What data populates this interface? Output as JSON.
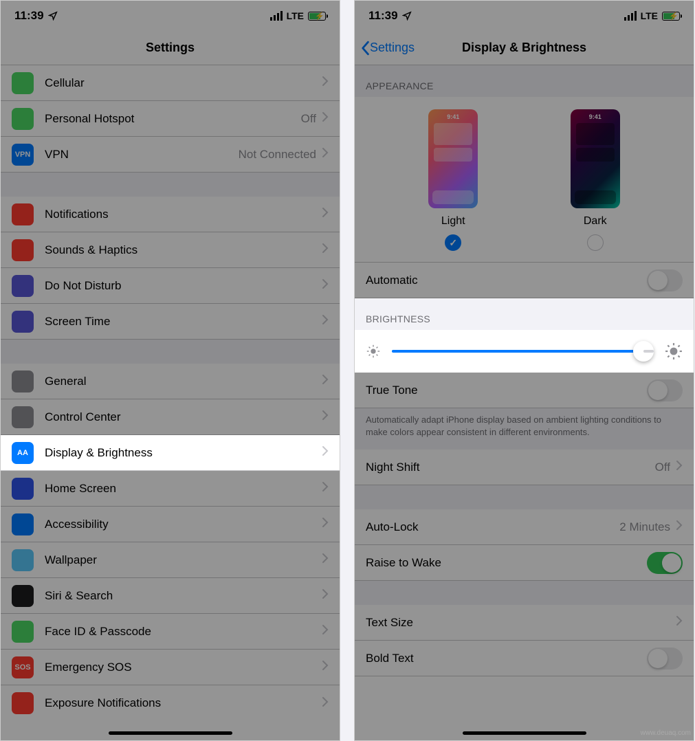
{
  "status": {
    "time": "11:39",
    "carrier": "LTE"
  },
  "left": {
    "title": "Settings",
    "groups": [
      [
        {
          "icon": "#4cd964",
          "label": "Cellular",
          "value": ""
        },
        {
          "icon": "#4cd964",
          "label": "Personal Hotspot",
          "value": "Off"
        },
        {
          "icon": "#007aff",
          "label": "VPN",
          "value": "Not Connected",
          "icon_text": "VPN"
        }
      ],
      [
        {
          "icon": "#ff3b30",
          "label": "Notifications"
        },
        {
          "icon": "#ff3b30",
          "label": "Sounds & Haptics"
        },
        {
          "icon": "#5856d6",
          "label": "Do Not Disturb"
        },
        {
          "icon": "#5856d6",
          "label": "Screen Time"
        }
      ],
      [
        {
          "icon": "#8e8e93",
          "label": "General"
        },
        {
          "icon": "#8e8e93",
          "label": "Control Center"
        },
        {
          "icon": "#007aff",
          "label": "Display & Brightness",
          "highlight": true,
          "icon_text": "AA"
        },
        {
          "icon": "#2f54eb",
          "label": "Home Screen"
        },
        {
          "icon": "#007aff",
          "label": "Accessibility"
        },
        {
          "icon": "#5ac8fa",
          "label": "Wallpaper"
        },
        {
          "icon": "#1c1c1e",
          "label": "Siri & Search"
        },
        {
          "icon": "#4cd964",
          "label": "Face ID & Passcode"
        },
        {
          "icon": "#ff3b30",
          "label": "Emergency SOS",
          "icon_text": "SOS"
        },
        {
          "icon": "#ff3b30",
          "label": "Exposure Notifications"
        }
      ]
    ]
  },
  "right": {
    "back": "Settings",
    "title": "Display & Brightness",
    "appearance_header": "APPEARANCE",
    "appearance": {
      "light": {
        "label": "Light",
        "time": "9:41",
        "selected": true
      },
      "dark": {
        "label": "Dark",
        "time": "9:41",
        "selected": false
      }
    },
    "automatic": {
      "label": "Automatic",
      "on": false
    },
    "brightness_header": "BRIGHTNESS",
    "brightness_percent": 96,
    "true_tone": {
      "label": "True Tone",
      "on": false
    },
    "true_tone_footer": "Automatically adapt iPhone display based on ambient lighting conditions to make colors appear consistent in different environments.",
    "night_shift": {
      "label": "Night Shift",
      "value": "Off"
    },
    "auto_lock": {
      "label": "Auto-Lock",
      "value": "2 Minutes"
    },
    "raise_wake": {
      "label": "Raise to Wake",
      "on": true
    },
    "text_size": {
      "label": "Text Size"
    },
    "bold_text": {
      "label": "Bold Text",
      "on": false
    }
  },
  "watermark": "www.deuaq.com"
}
